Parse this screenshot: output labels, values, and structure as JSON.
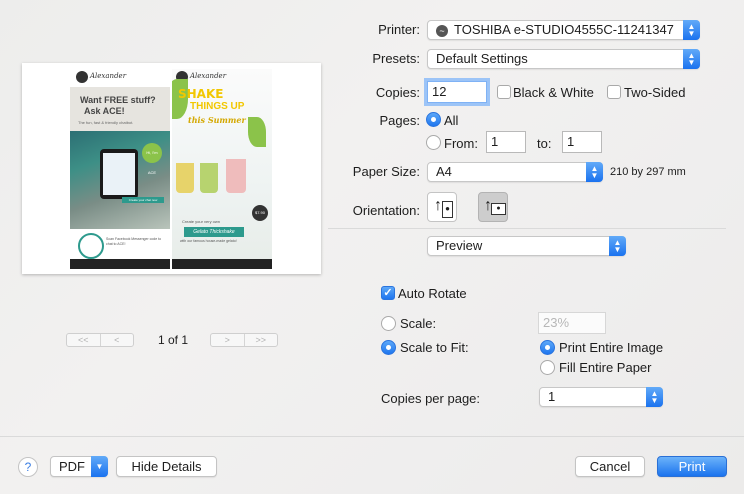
{
  "printer": {
    "label": "Printer:",
    "value": "TOSHIBA e-STUDIO4555C-11241347"
  },
  "presets": {
    "label": "Presets:",
    "value": "Default Settings"
  },
  "copies": {
    "label": "Copies:",
    "value": "12"
  },
  "black_white": {
    "label": "Black & White",
    "checked": false
  },
  "two_sided": {
    "label": "Two-Sided",
    "checked": false
  },
  "pages": {
    "label": "Pages:",
    "all_label": "All",
    "from_label": "From:",
    "from_value": "1",
    "to_label": "to:",
    "to_value": "1"
  },
  "paper_size": {
    "label": "Paper Size:",
    "value": "A4",
    "dimensions": "210 by 297 mm"
  },
  "orientation": {
    "label": "Orientation:"
  },
  "section": {
    "value": "Preview"
  },
  "auto_rotate": {
    "label": "Auto Rotate",
    "checked": true
  },
  "scale": {
    "label": "Scale:",
    "value": "23%"
  },
  "scale_to_fit": {
    "label": "Scale to Fit:",
    "print_entire": "Print Entire Image",
    "fill_entire": "Fill Entire Paper"
  },
  "copies_per_page": {
    "label": "Copies per page:",
    "value": "1"
  },
  "preview_nav": {
    "page_label": "1 of 1",
    "first": "<<",
    "prev": "<",
    "next": ">",
    "last": ">>"
  },
  "bottom": {
    "help": "?",
    "pdf": "PDF",
    "hide_details": "Hide Details",
    "cancel": "Cancel",
    "print": "Print"
  },
  "flyer_left": {
    "brand": "Alexander",
    "headline1": "Want FREE stuff?",
    "headline2": "Ask ACE!",
    "tagline": "The fun, fast & friendly chatbot.",
    "badge": "Hi, I'm ACE",
    "cta": "Create your chat now",
    "messenger": "Scan Facebook Messenger code to chat to ACE!"
  },
  "flyer_right": {
    "brand": "Alexander",
    "headline1": "SHAKE",
    "headline2": "THINGS UP",
    "sub": "this Summer",
    "price": "$7.90",
    "create": "Create your very own",
    "thickshake": "Gelato Thickshake",
    "with": "with our famous house-made gelato!"
  },
  "colors": {
    "accent": "#1b73ee",
    "teal": "#2d9a8d",
    "yellow": "#ffcc00"
  }
}
